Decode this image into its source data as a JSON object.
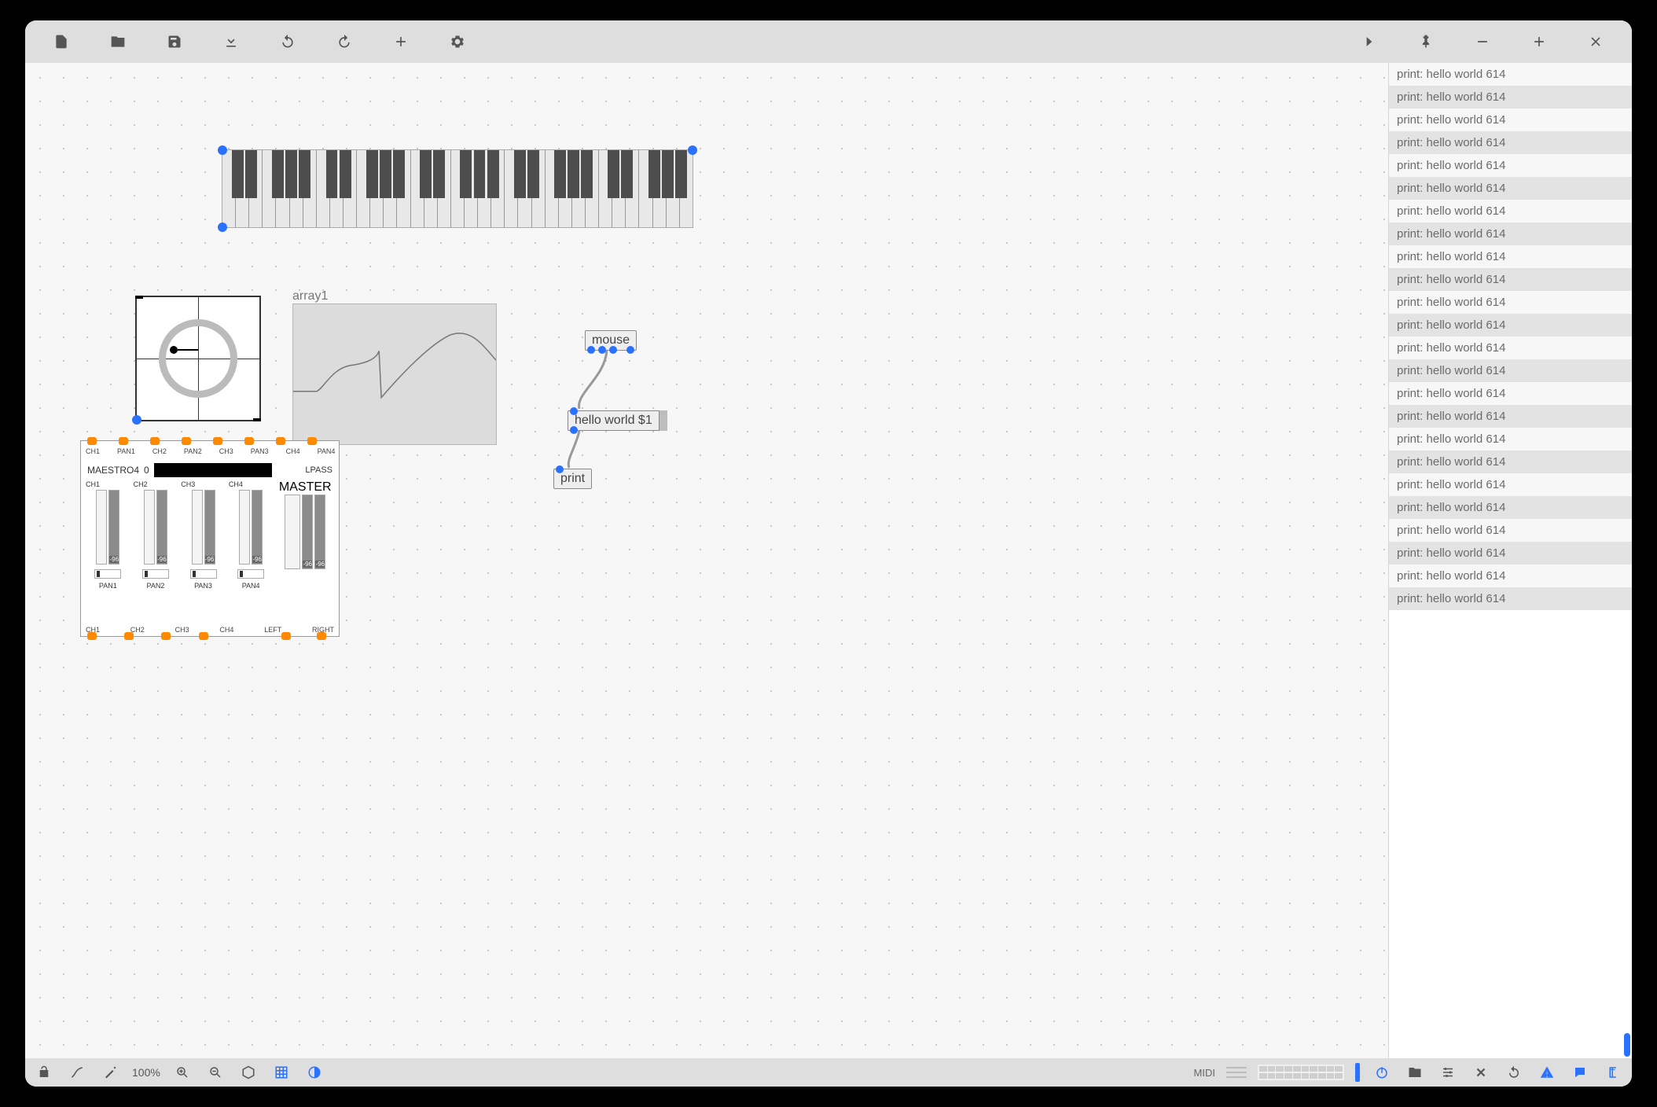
{
  "toolbar": {
    "icons": [
      "file",
      "folder",
      "save",
      "download",
      "undo",
      "redo",
      "add",
      "settings",
      "chevron",
      "pin",
      "minus",
      "plus",
      "close"
    ]
  },
  "piano": {
    "octaves": 5
  },
  "scope": {
    "label": ""
  },
  "array": {
    "label": "array1"
  },
  "patch": {
    "mouse_label": "mouse",
    "msg_label": "hello world $1",
    "print_label": "print"
  },
  "mixer": {
    "top_labels": [
      "CH1",
      "PAN1",
      "CH2",
      "PAN2",
      "CH3",
      "PAN3",
      "CH4",
      "PAN4"
    ],
    "name": "MAESTRO4",
    "preset": "0",
    "filter": "LPASS",
    "channels": [
      {
        "label": "CH1",
        "db": "-96",
        "pan": "PAN1"
      },
      {
        "label": "CH2",
        "db": "-96",
        "pan": "PAN2"
      },
      {
        "label": "CH3",
        "db": "-96",
        "pan": "PAN3"
      },
      {
        "label": "CH4",
        "db": "-96",
        "pan": "PAN4"
      }
    ],
    "master": {
      "label": "MASTER",
      "db": "-96"
    },
    "bottom_labels": [
      "CH1",
      "CH2",
      "CH3",
      "CH4",
      "LEFT",
      "RIGHT"
    ]
  },
  "console": {
    "message": "print: hello world 614",
    "count": 24
  },
  "statusbar": {
    "zoom": "100%",
    "midi_label": "MIDI"
  }
}
